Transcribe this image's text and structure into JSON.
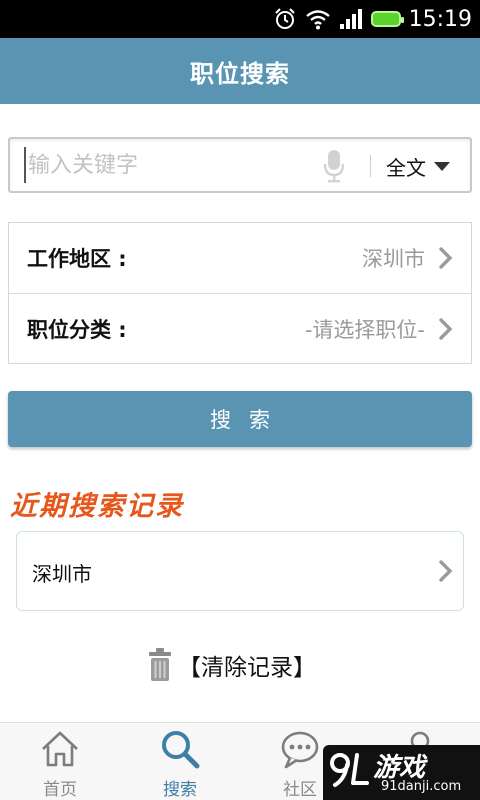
{
  "status_bar": {
    "time": "15:19"
  },
  "header": {
    "title": "职位搜索"
  },
  "search": {
    "placeholder": "输入关键字",
    "value": "",
    "scope": "全文"
  },
  "filters": [
    {
      "label": "工作地区 :",
      "value": "深圳市"
    },
    {
      "label": "职位分类 :",
      "value": "-请选择职位-"
    }
  ],
  "search_button": {
    "label": "搜索"
  },
  "recent": {
    "title": "近期搜索记录",
    "items": [
      {
        "label": "深圳市"
      }
    ]
  },
  "clear": {
    "label": "【清除记录】"
  },
  "tabs": [
    {
      "label": "首页",
      "icon": "home-icon",
      "active": false
    },
    {
      "label": "搜索",
      "icon": "search-icon",
      "active": true
    },
    {
      "label": "社区",
      "icon": "chat-icon",
      "active": false
    },
    {
      "label": "",
      "icon": "profile-icon",
      "active": false
    }
  ],
  "watermark": {
    "main": "游戏",
    "sub": "91danji.com"
  },
  "colors": {
    "primary": "#5a94b3",
    "accent": "#e8571a",
    "battery": "#5cd32a"
  }
}
